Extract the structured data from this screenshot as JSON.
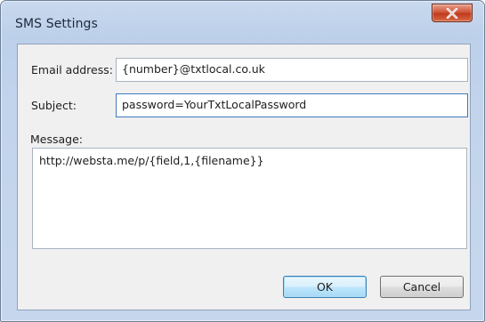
{
  "window": {
    "title": "SMS Settings"
  },
  "form": {
    "email_label": "Email address:",
    "email_value": "{number}@txtlocal.co.uk",
    "subject_label": "Subject:",
    "subject_value": "password=YourTxtLocalPassword",
    "message_label": "Message:",
    "message_value": "http://websta.me/p/{field,1,{filename}}"
  },
  "buttons": {
    "ok_label": "OK",
    "cancel_label": "Cancel"
  },
  "icons": {
    "close": "close-icon"
  },
  "colors": {
    "close_button": "#c9452a",
    "focus_border": "#3d7bbd",
    "default_button": "#bee6fd"
  }
}
